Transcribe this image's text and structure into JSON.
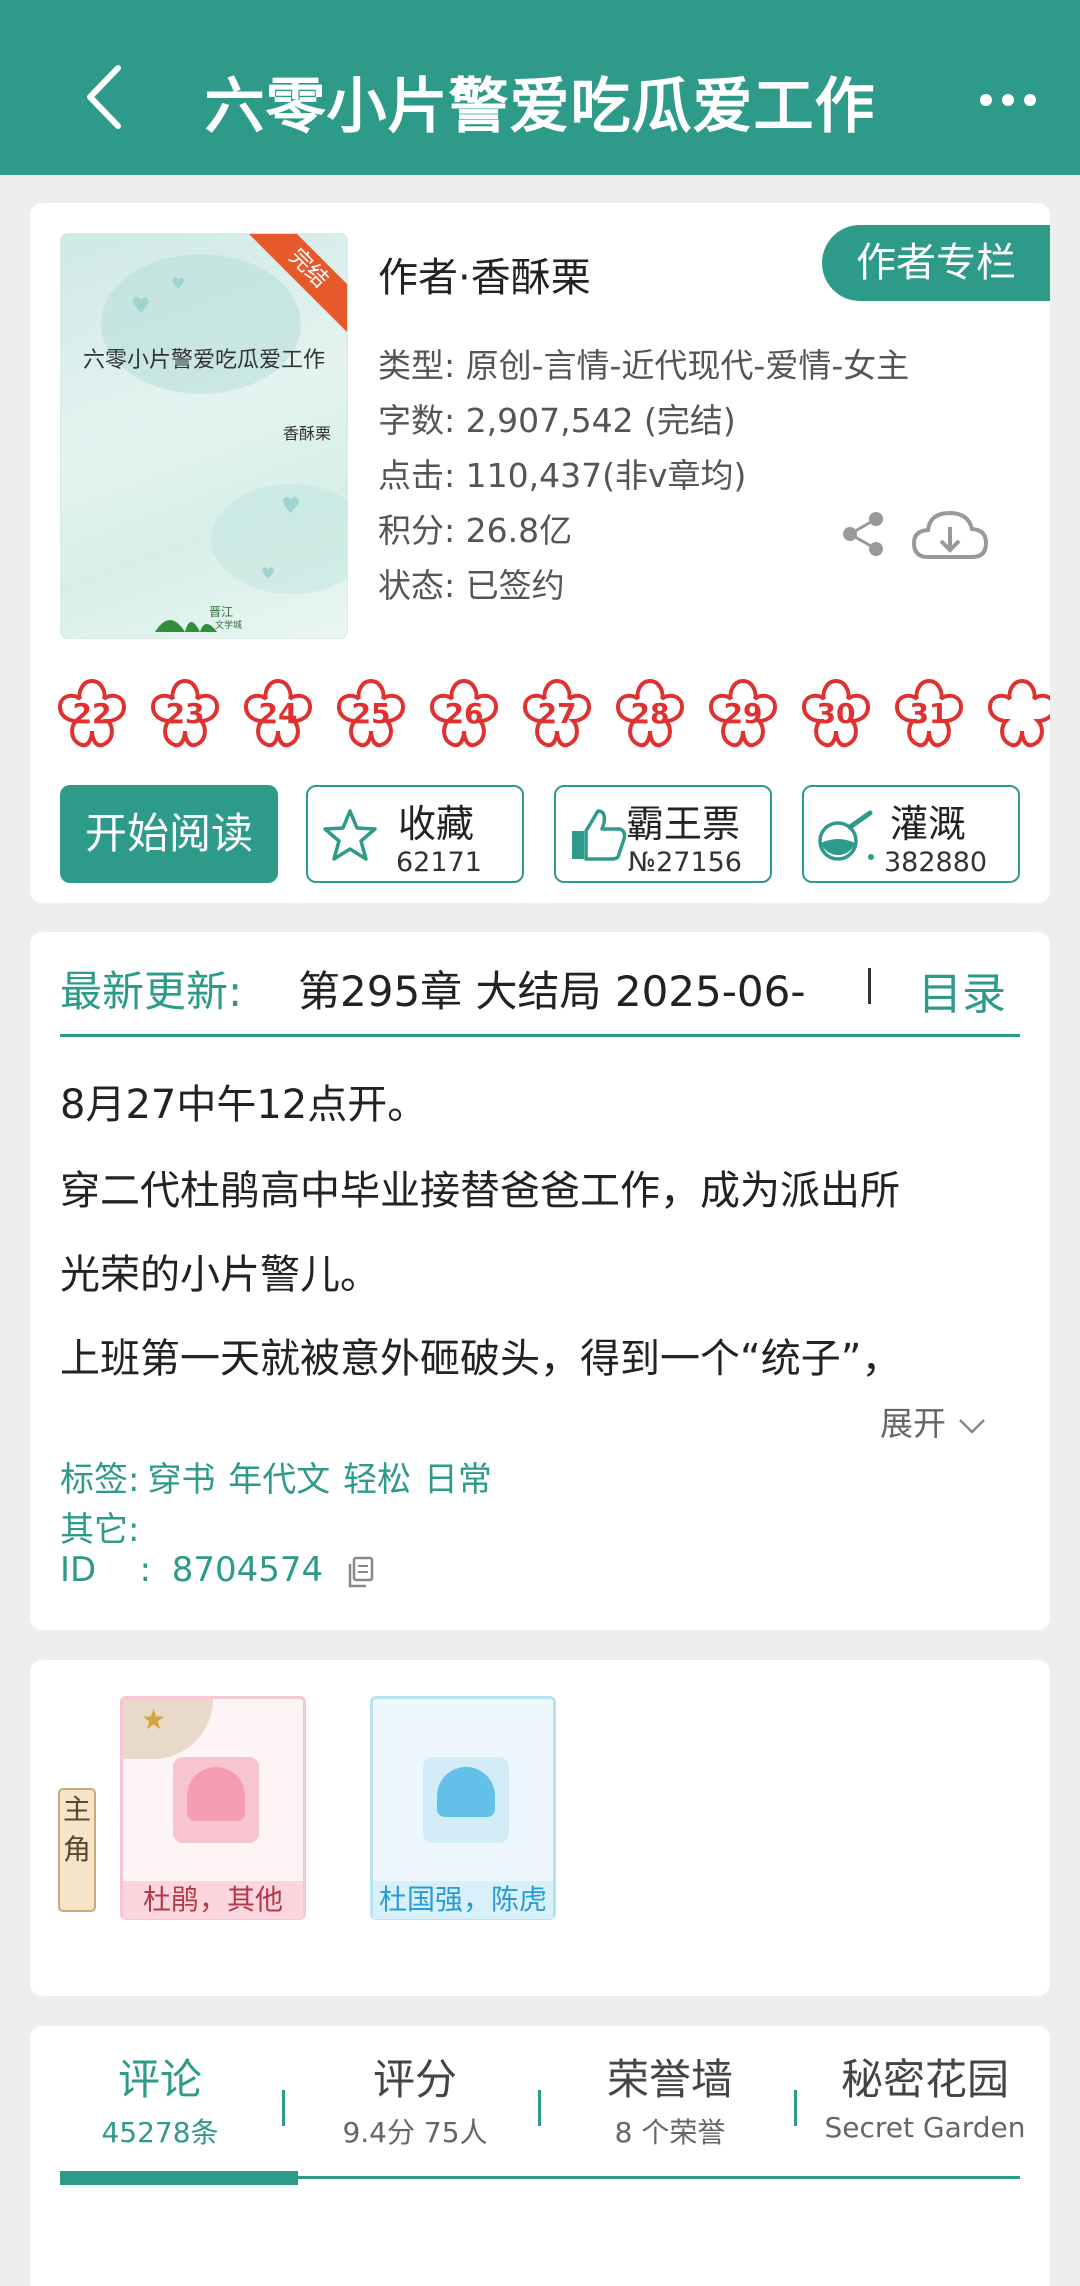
{
  "header": {
    "title": "六零小片警爱吃瓜爱工作",
    "back_icon": "chevron-left-icon",
    "more_icon": "more-dots-icon",
    "color": "#2e9a8a"
  },
  "book": {
    "cover_title": "六零小片警爱吃瓜爱工作",
    "cover_author": "香酥栗",
    "cover_badge": "完结",
    "author_line": "作者·香酥栗",
    "author_column_button": "作者专栏",
    "meta": {
      "type": "类型: 原创-言情-近代现代-爱情-女主",
      "words": "字数: 2,907,542 (完结)",
      "clicks": "点击: 110,437(非v章均)",
      "score": "积分: 26.8亿",
      "status": "状态: 已签约"
    },
    "flowers": [
      "22",
      "23",
      "24",
      "25",
      "26",
      "27",
      "28",
      "29",
      "30",
      "31"
    ],
    "read_button": "开始阅读",
    "actions": {
      "collect": {
        "label": "收藏",
        "count": "62171",
        "icon": "star-icon"
      },
      "vote": {
        "label": "霸王票",
        "count": "№27156",
        "icon": "thumbs-up-icon"
      },
      "water": {
        "label": "灌溉",
        "count": "382880",
        "icon": "flask-icon"
      }
    }
  },
  "update": {
    "label": "最新更新:",
    "chapter": "第295章  大结局  2025-06-",
    "toc": "目录",
    "desc": [
      "8月27中午12点开。",
      "穿二代杜鹃高中毕业接替爸爸工作，成为派出所",
      "光荣的小片警儿。",
      "上班第一天就被意外砸破头，得到一个“统子”，"
    ],
    "expand": "展开",
    "tags_label": "标签:",
    "tags": "穿书 年代文 轻松 日常",
    "other_label": "其它:",
    "id_label": "ID    :",
    "id_value": "8704574"
  },
  "roles": {
    "main_tag": "主角",
    "cards": [
      {
        "name": "杜鹃，其他"
      },
      {
        "name": "杜国强，陈虎"
      }
    ]
  },
  "tabs": [
    {
      "title": "评论",
      "sub": "45278条"
    },
    {
      "title": "评分",
      "sub": "9.4分 75人"
    },
    {
      "title": "荣誉墙",
      "sub": "8 个荣誉"
    },
    {
      "title": "秘密花园",
      "sub": "Secret Garden"
    }
  ]
}
